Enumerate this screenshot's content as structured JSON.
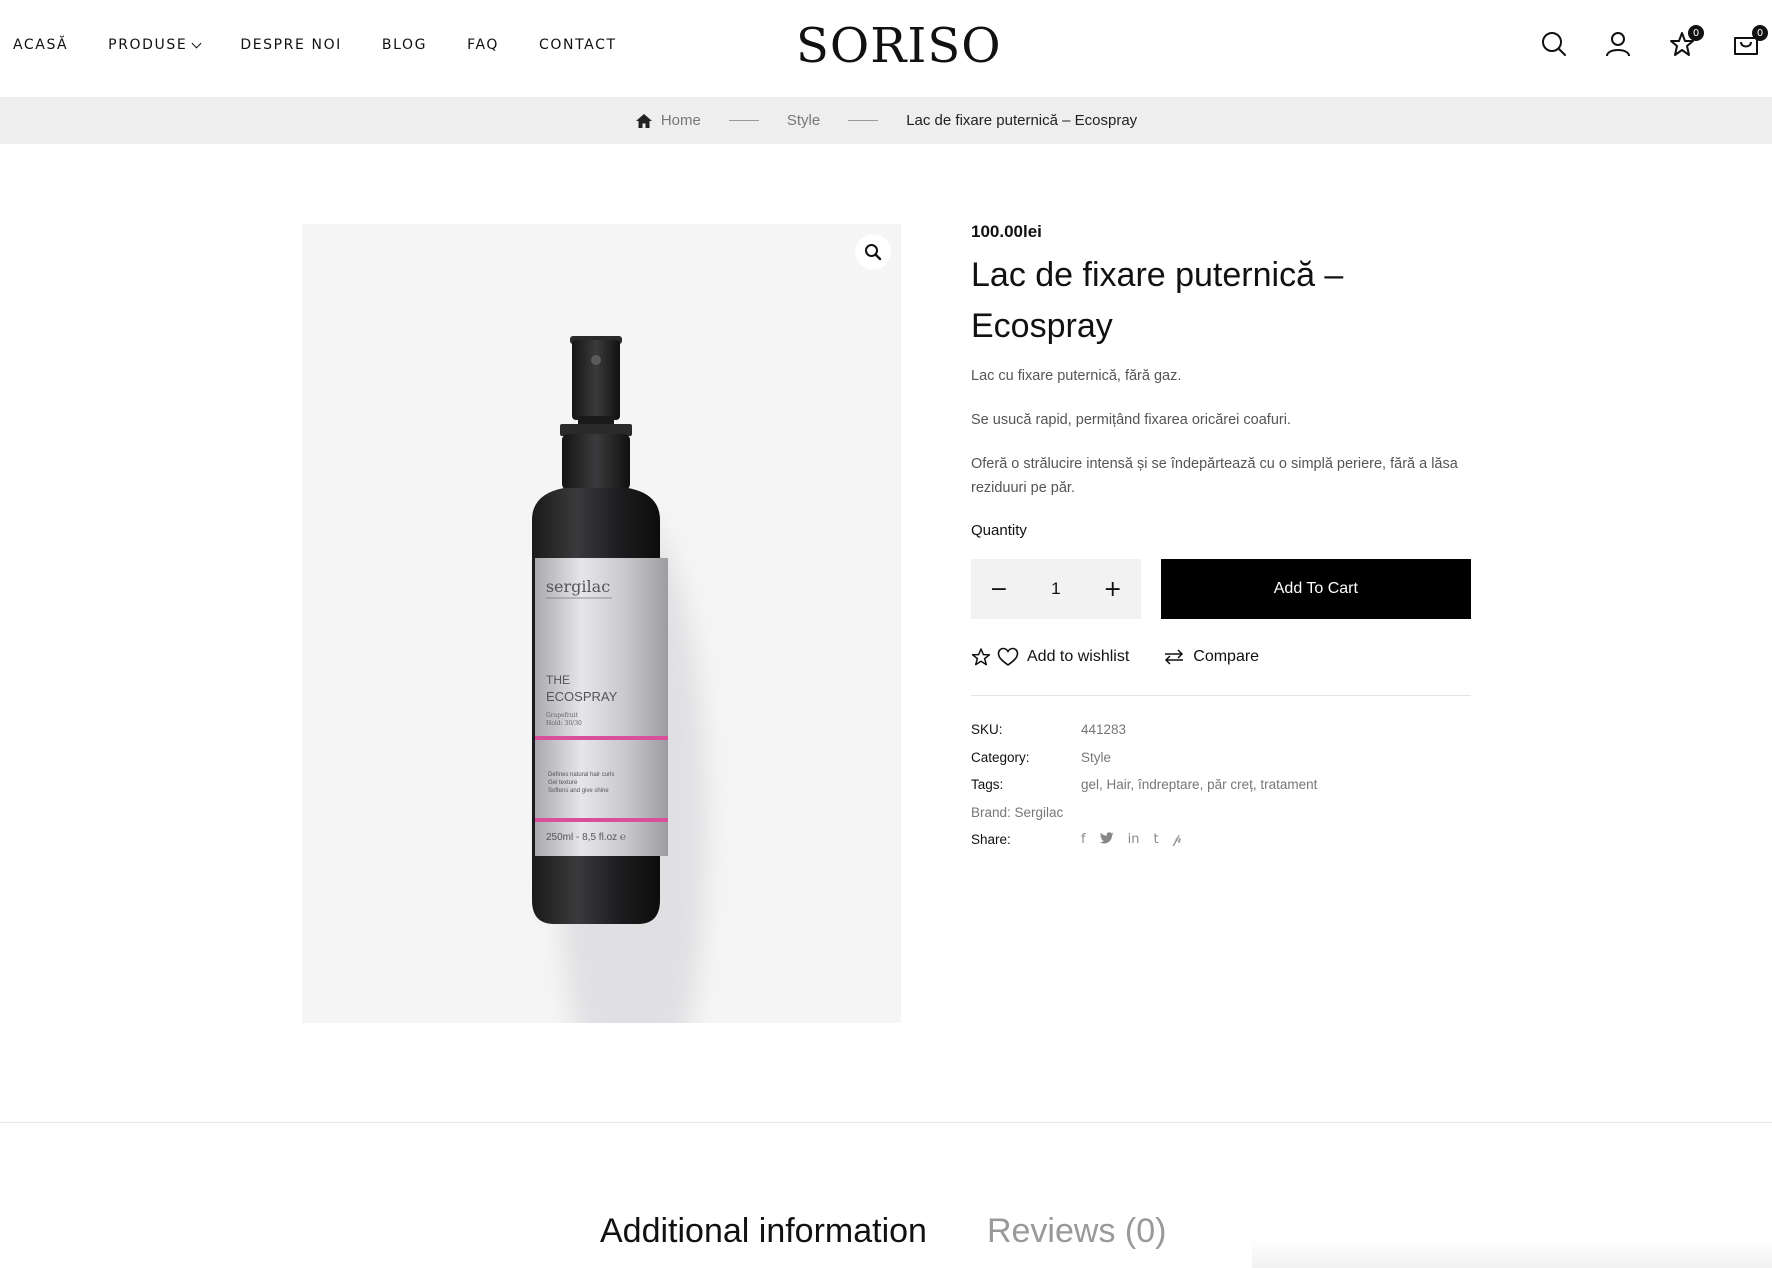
{
  "header": {
    "nav": [
      "ACASĂ",
      "PRODUSE",
      "DESPRE NOI",
      "BLOG",
      "FAQ",
      "CONTACT"
    ],
    "logo": "SORISO",
    "wishlist_count": "0",
    "cart_count": "0"
  },
  "breadcrumb": {
    "home": "Home",
    "category": "Style",
    "current": "Lac de fixare puternică – Ecospray"
  },
  "product": {
    "price": "100.00lei",
    "title": "Lac de fixare puternică – Ecospray",
    "description": [
      "Lac cu fixare puternică, fără gaz.",
      "Se usucă rapid, permițând fixarea oricărei coafuri.",
      "Oferă o strălucire intensă și se îndepărtează cu o simplă periere, fără a lăsa reziduuri pe păr."
    ],
    "quantity_label": "Quantity",
    "quantity": "1",
    "add_to_cart": "Add To Cart",
    "wishlist": "Add to wishlist",
    "compare": "Compare",
    "meta": {
      "sku_label": "SKU:",
      "sku": "441283",
      "category_label": "Category:",
      "category": "Style",
      "tags_label": "Tags:",
      "tags": "gel, Hair, îndreptare, păr creț, tratament",
      "brand": "Brand: Sergilac",
      "share_label": "Share:"
    },
    "image": {
      "brand": "sergilac",
      "line1": "THE",
      "line2": "ECOSPRAY",
      "small1": "Grapefruit",
      "small2": "Hold: 30/30",
      "desc1": "Defines natural hair curls",
      "desc2": "Gel texture",
      "desc3": "Softens and give shine",
      "volume": "250ml - 8,5 fl.oz ℮"
    }
  },
  "tabs": [
    "Additional information",
    "Reviews (0)"
  ],
  "colors": {
    "accent": "#000000",
    "label_pink": "#d94f9a"
  },
  "icons": [
    "search-icon",
    "user-icon",
    "star-icon",
    "cart-icon",
    "home-icon",
    "zoom-icon",
    "heart-icon",
    "compare-icon",
    "facebook-icon",
    "twitter-icon",
    "linkedin-icon",
    "tumblr-icon",
    "pinterest-icon"
  ]
}
